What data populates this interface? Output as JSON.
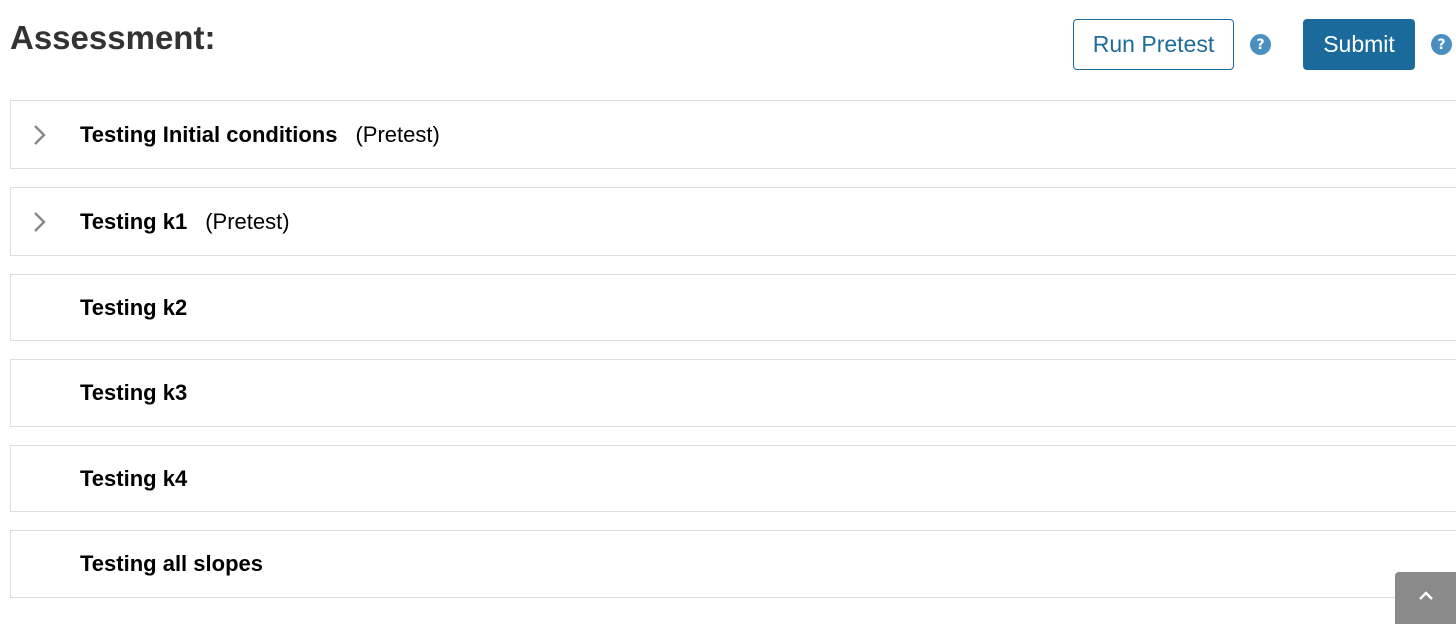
{
  "header": {
    "title": "Assessment:",
    "run_pretest_label": "Run Pretest",
    "submit_label": "Submit",
    "help_glyph": "?"
  },
  "colors": {
    "primary": "#1a6a9c",
    "help_icon": "#4a8fc0",
    "panel_border": "#dddddd",
    "scroll_button": "#8a8a8a"
  },
  "panels": [
    {
      "label": "Testing Initial conditions",
      "tag": "(Pretest)",
      "expandable": true
    },
    {
      "label": "Testing k1",
      "tag": "(Pretest)",
      "expandable": true
    },
    {
      "label": "Testing k2",
      "tag": "",
      "expandable": false
    },
    {
      "label": "Testing k3",
      "tag": "",
      "expandable": false
    },
    {
      "label": "Testing k4",
      "tag": "",
      "expandable": false
    },
    {
      "label": "Testing all slopes",
      "tag": "",
      "expandable": false
    }
  ],
  "icons": {
    "chevron": "chevron-right-icon",
    "help": "question-circle-icon",
    "scroll_top": "chevron-up-icon"
  }
}
